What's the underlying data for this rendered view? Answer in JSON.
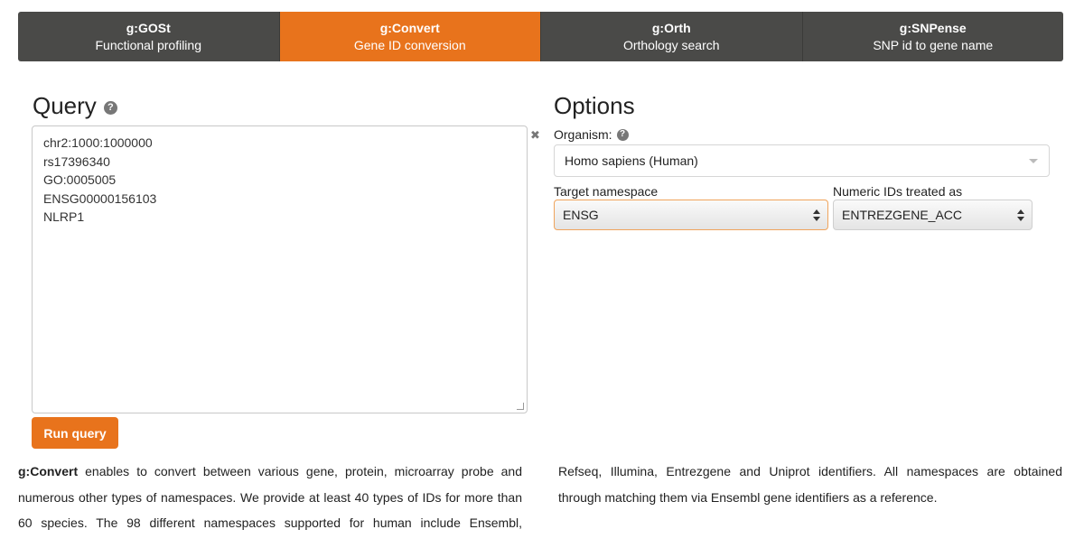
{
  "tabs": [
    {
      "title": "g:GOSt",
      "subtitle": "Functional profiling"
    },
    {
      "title": "g:Convert",
      "subtitle": "Gene ID conversion"
    },
    {
      "title": "g:Orth",
      "subtitle": "Orthology search"
    },
    {
      "title": "g:SNPense",
      "subtitle": "SNP id to gene name"
    }
  ],
  "active_tab": "g:Convert",
  "colors": {
    "accent": "#e8731c",
    "tab_bg": "#4a4a48"
  },
  "query": {
    "title": "Query",
    "lines": [
      "chr2:1000:1000000",
      "rs17396340",
      "GO:0005005",
      "ENSG00000156103",
      "NLRP1"
    ],
    "run_label": "Run query"
  },
  "options": {
    "title": "Options",
    "organism_label": "Organism:",
    "organism_value": "Homo sapiens (Human)",
    "target_label": "Target namespace",
    "target_value": "ENSG",
    "numeric_label": "Numeric IDs treated as",
    "numeric_value": "ENTREZGENE_ACC"
  },
  "description": {
    "bold_lead": "g:Convert",
    "col1_lines": [
      " enables to convert between various gene, protein, microarray probe and",
      "numerous other types of namespaces. We provide at least 40 types of IDs for more than",
      "60 species. The 98 different namespaces supported for human include Ensembl,"
    ],
    "col2_lines": [
      "Refseq, Illumina, Entrezgene and Uniprot identifiers. All namespaces are obtained",
      "through matching them via Ensembl gene identifiers as a reference."
    ]
  }
}
